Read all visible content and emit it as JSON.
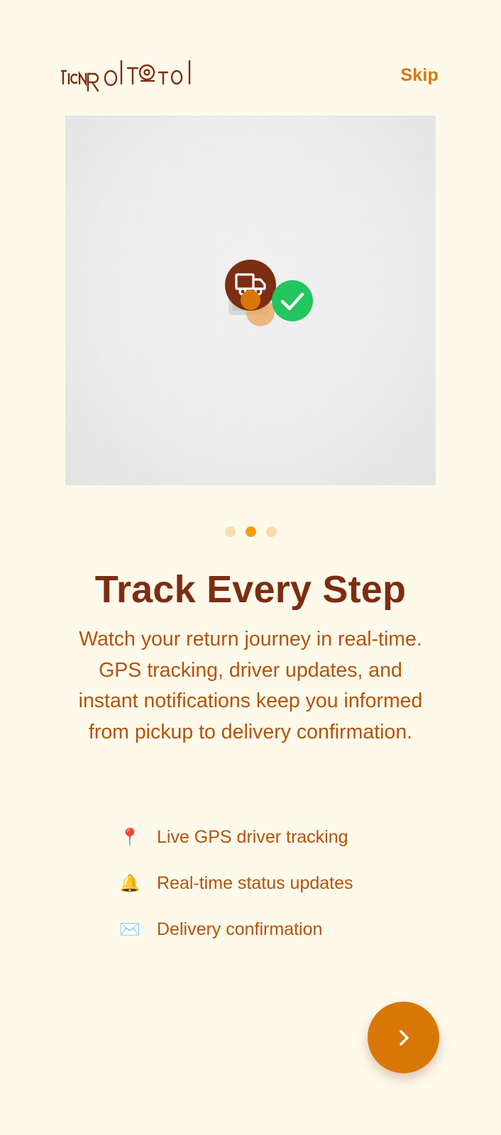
{
  "app": {
    "logo_text": "ReturnRoute"
  },
  "header": {
    "skip_label": "Skip"
  },
  "hero": {
    "illustration_icons": [
      "truck-icon",
      "checkmark-icon"
    ]
  },
  "pagination": {
    "total": 3,
    "active_index": 1
  },
  "content": {
    "title": "Track Every Step",
    "description": "Watch your return journey in real-time. GPS tracking, driver updates, and instant notifications keep you informed from pickup to delivery confirmation."
  },
  "features": [
    {
      "icon": "map-pin-icon",
      "glyph": "📍",
      "label": "Live GPS driver tracking"
    },
    {
      "icon": "bell-icon",
      "glyph": "🔔",
      "label": "Real-time status updates"
    },
    {
      "icon": "envelope-icon",
      "glyph": "✉️",
      "label": "Delivery confirmation"
    }
  ],
  "next_button": {
    "icon": "chevron-right-icon"
  },
  "colors": {
    "background": "#fefaeb",
    "primary": "#d97706",
    "heading": "#7c2d12",
    "body_text": "#b45309",
    "dot_inactive": "#fbdcaa",
    "dot_active": "#f59e0b",
    "success": "#22c55e"
  }
}
